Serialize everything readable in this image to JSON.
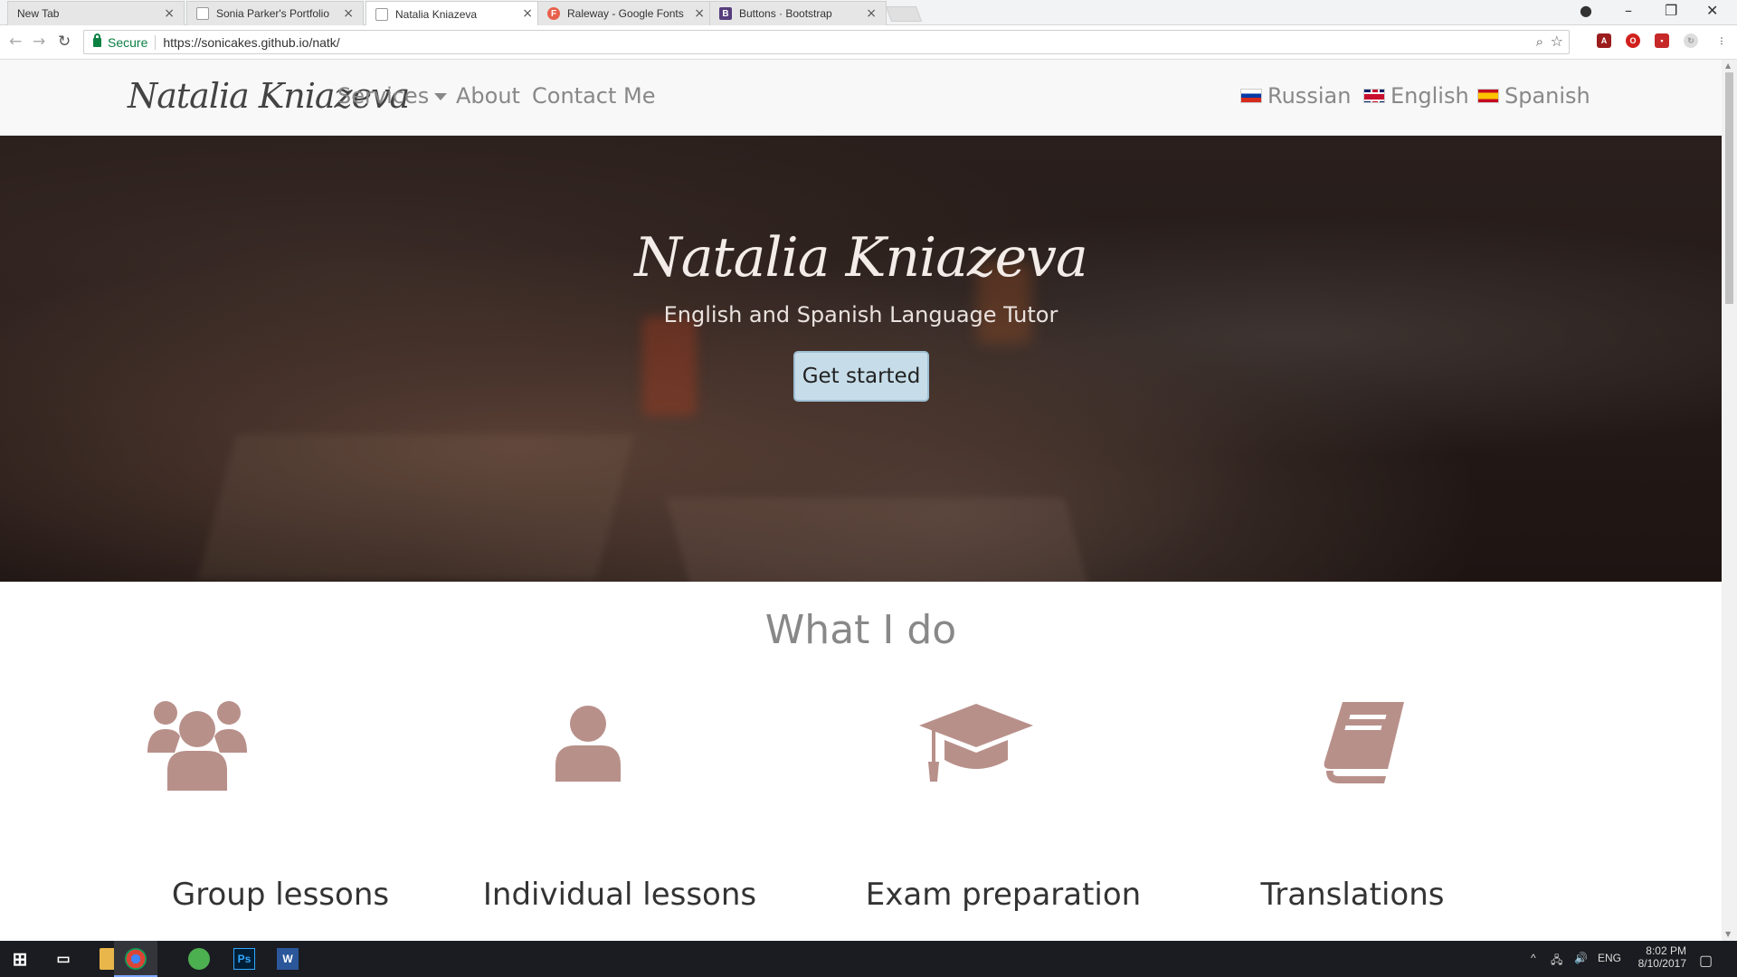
{
  "browser": {
    "tabs": [
      {
        "title": "New Tab"
      },
      {
        "title": "Sonia Parker's Portfolio"
      },
      {
        "title": "Natalia Kniazeva"
      },
      {
        "title": "Raleway - Google Fonts",
        "favicon": "F"
      },
      {
        "title": "Buttons · Bootstrap",
        "favicon": "B"
      }
    ],
    "active_tab": 2,
    "secure_label": "Secure",
    "url": "https://sonicakes.github.io/natk/"
  },
  "site": {
    "brand": "Natalia Kniazeva",
    "nav": {
      "services": "Services",
      "about": "About",
      "contact": "Contact Me"
    },
    "languages": [
      "Russian",
      "English",
      "Spanish"
    ]
  },
  "hero": {
    "title": "Natalia Kniazeva",
    "subtitle": "English and Spanish Language Tutor",
    "cta": "Get started"
  },
  "what_i_do": {
    "title": "What I do",
    "services": [
      {
        "label": "Group lessons",
        "icon": "users-icon"
      },
      {
        "label": "Individual lessons",
        "icon": "user-icon"
      },
      {
        "label": "Exam preparation",
        "icon": "graduation-cap-icon"
      },
      {
        "label": "Translations",
        "icon": "book-icon"
      }
    ]
  },
  "taskbar": {
    "language": "ENG",
    "time": "8:02 PM",
    "date": "8/10/2017"
  },
  "colors": {
    "icon": "#b8908a",
    "cta_bg": "#c6dde9",
    "nav_bg": "#f8f8f8"
  }
}
